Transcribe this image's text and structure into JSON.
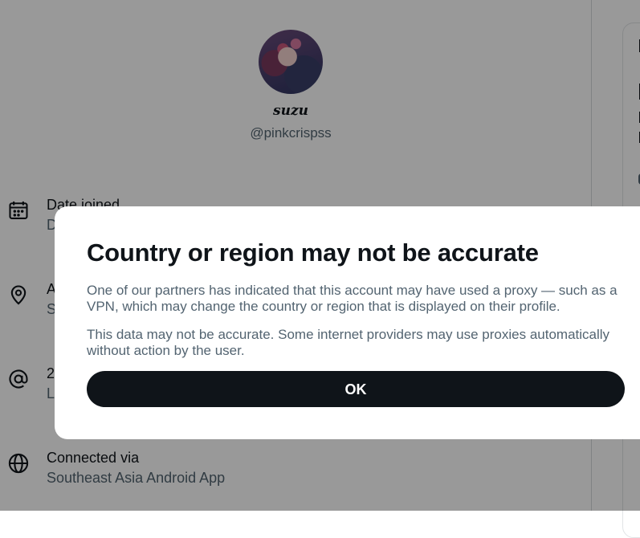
{
  "profile": {
    "display_name": "suzu",
    "handle": "@pinkcrispss"
  },
  "about_rows": [
    {
      "label": "Date joined",
      "value": "D",
      "icon": "calendar-icon"
    },
    {
      "label": "A",
      "value": "S",
      "icon": "location-pin-icon"
    },
    {
      "label": "2",
      "value": "L",
      "icon": "at-sign-icon"
    },
    {
      "label": "Connected via",
      "value": "Southeast Asia Android App",
      "icon": "globe-icon"
    }
  ],
  "dialog": {
    "title": "Country or region may not be accurate",
    "paragraph1": "One of our partners has indicated that this account may have used a proxy — such as a VPN, which may change the country or region that is displayed on their profile.",
    "paragraph2": "This data may not be accurate. Some internet providers may use proxies automatically without action by the user.",
    "ok_label": "OK"
  },
  "colors": {
    "text_primary": "#0f1419",
    "text_secondary": "#536471",
    "button_bg": "#0f1419",
    "overlay": "rgba(0,0,0,0.4)"
  }
}
